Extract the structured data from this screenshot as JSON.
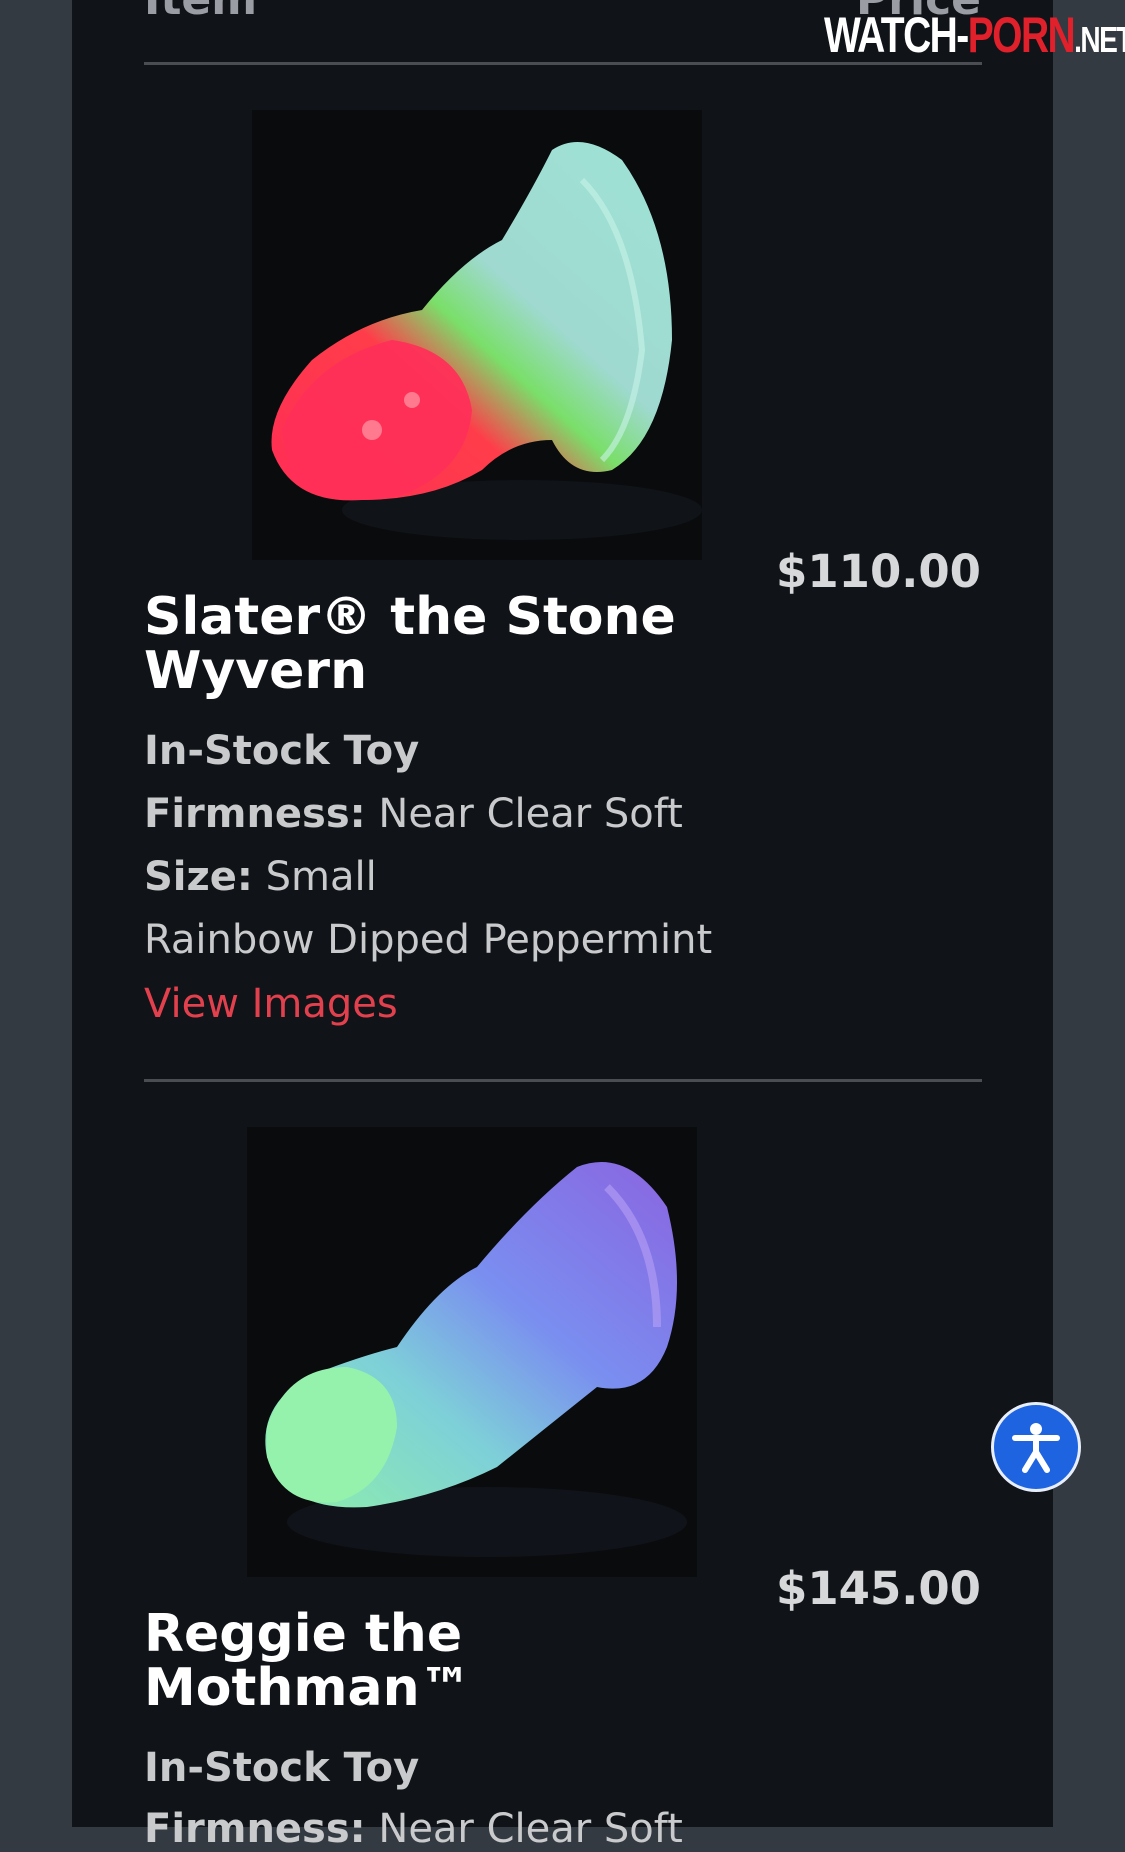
{
  "table_header": {
    "item": "Item",
    "price": "Price"
  },
  "products": [
    {
      "title": "Slater® the Stone Wyvern",
      "price": "$110.00",
      "stock": "In-Stock Toy",
      "firmness_label": "Firmness:",
      "firmness_value": "Near Clear Soft",
      "size_label": "Size:",
      "size_value": "Small",
      "color": "Rainbow Dipped Peppermint",
      "link": "View Images"
    },
    {
      "title": "Reggie the Mothman™",
      "price": "$145.00",
      "stock": "In-Stock Toy",
      "firmness_label": "Firmness:",
      "firmness_value": "Near Clear Soft"
    }
  ],
  "watermark": {
    "part1": "WATCH-",
    "part2": "PORN",
    "part3": ".NET"
  },
  "colors": {
    "background": "#101318",
    "link": "#e2404d",
    "accessibility_button": "#1e63e0"
  },
  "icons": {
    "accessibility": "accessibility-person-icon"
  }
}
